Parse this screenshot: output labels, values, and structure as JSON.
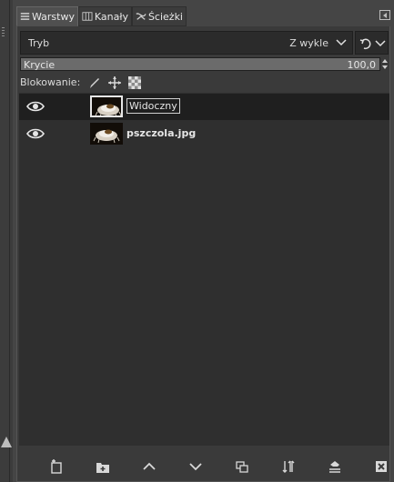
{
  "tabs": [
    {
      "label": "Warstwy",
      "icon": "layers-icon",
      "active": true
    },
    {
      "label": "Kanały",
      "icon": "channels-icon",
      "active": false
    },
    {
      "label": "Ścieżki",
      "icon": "paths-icon",
      "active": false
    }
  ],
  "mode": {
    "label": "Tryb",
    "value": "Z wykle"
  },
  "opacity": {
    "label": "Krycie",
    "value": "100,0",
    "fraction": 1.0
  },
  "lock": {
    "label": "Blokowanie:",
    "icons": [
      "lock-pixels-icon",
      "lock-position-icon",
      "lock-alpha-icon"
    ]
  },
  "layers": [
    {
      "name": "Widoczny",
      "visible": true,
      "selected": true,
      "editing": true
    },
    {
      "name": "pszczola.jpg",
      "visible": true,
      "selected": false,
      "editing": false
    }
  ],
  "bottom_buttons": [
    "new-layer-icon",
    "new-layer-group-icon",
    "raise-layer-icon",
    "lower-layer-icon",
    "duplicate-layer-icon",
    "merge-layer-icon",
    "anchor-layer-icon",
    "delete-layer-icon"
  ]
}
